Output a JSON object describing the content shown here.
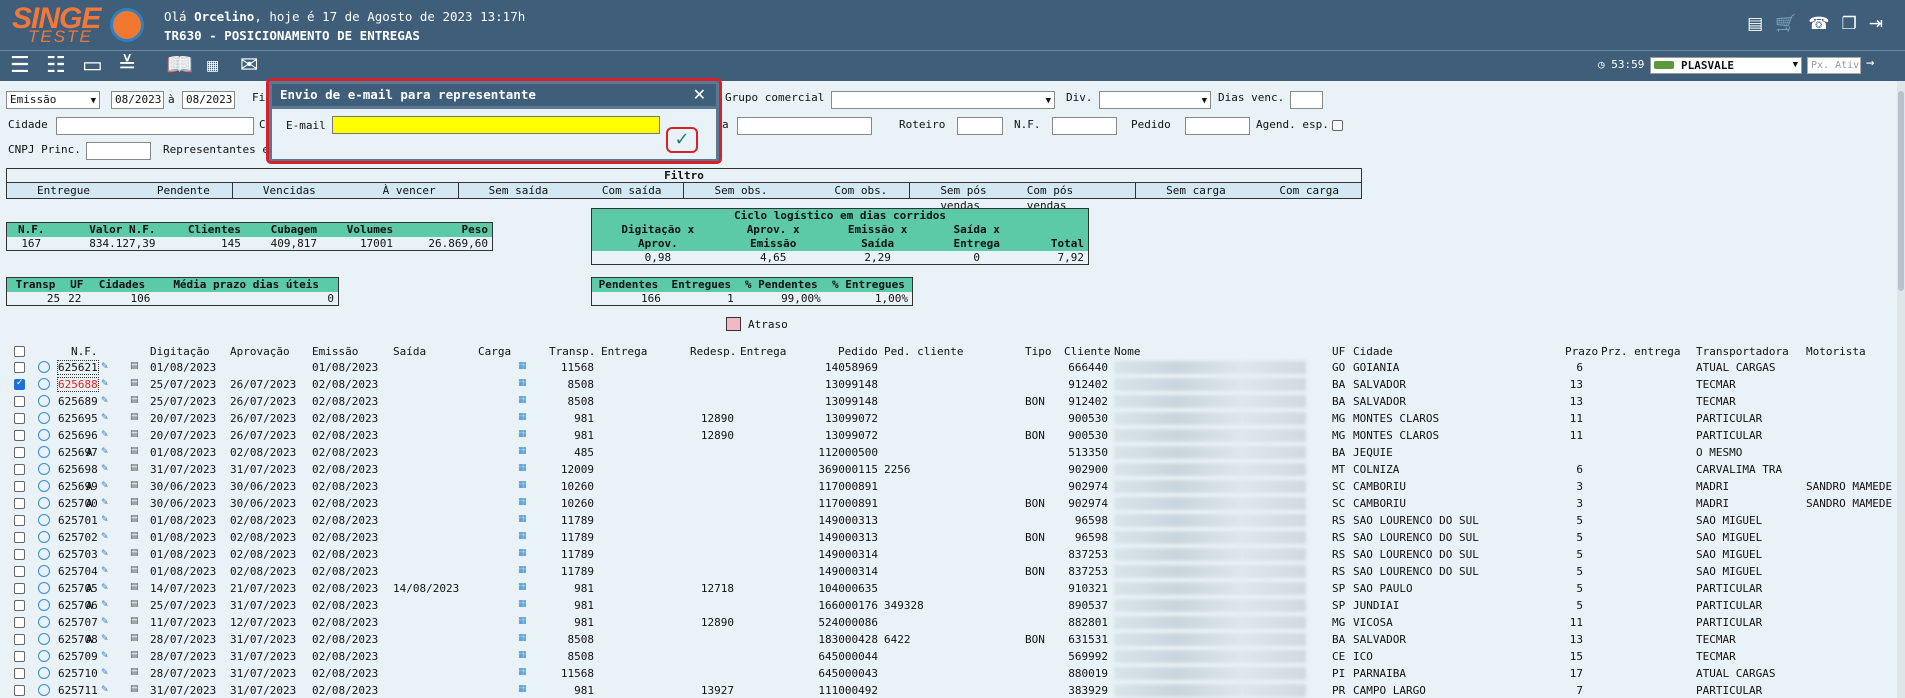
{
  "header": {
    "brand_top": "SINGE",
    "brand_bottom": "TESTE",
    "greeting_prefix": "Olá ",
    "user": "Orcelino",
    "greeting_suffix": ", hoje é 17 de Agosto de 2023 13:17h",
    "screen_title": "TR630 - POSICIONAMENTO DE ENTREGAS",
    "icons": [
      "document-icon",
      "cart-icon",
      "phone-icon",
      "copy-icon",
      "logout-icon"
    ]
  },
  "toolbar": {
    "time": "53:59",
    "company": "PLASVALE",
    "px_placeholder": "Px. Ativ",
    "icons": [
      "list-icon",
      "checklist-icon",
      "form-icon",
      "chevron-stack-icon",
      "book-icon",
      "csv-icon",
      "email-icon"
    ]
  },
  "filters": {
    "date_type": "Emissão",
    "date_from": "08/2023",
    "to_label": "à",
    "date_to": "08/2023",
    "fi_label": "Fi",
    "grupo_label": "Grupo comercial",
    "div_label": "Div.",
    "dias_label": "Dias venc.",
    "cidade_label": "Cidade",
    "c_label": "C",
    "a_label": "a",
    "roteiro_label": "Roteiro",
    "nf_label": "N.F.",
    "pedido_label": "Pedido",
    "agend_label": "Agend. esp.",
    "cnpj_label": "CNPJ Princ.",
    "repr_label": "Representantes e"
  },
  "filtro": {
    "title": "Filtro",
    "groups": [
      [
        "Entregue",
        "Pendente"
      ],
      [
        "Vencidas",
        "À vencer"
      ],
      [
        "Sem saída",
        "Com saída"
      ],
      [
        "Sem obs.",
        "Com obs."
      ],
      [
        "Sem pós vendas",
        "Com pós vendas"
      ],
      [
        "Sem carga",
        "Com carga"
      ]
    ]
  },
  "summary": {
    "headers": [
      "N.F.",
      "Valor N.F.",
      "Clientes",
      "Cubagem",
      "Volumes",
      "Peso"
    ],
    "values": [
      "167",
      "834.127,39",
      "145",
      "409,817",
      "17001",
      "26.869,60"
    ]
  },
  "transp": {
    "headers": [
      "Transp",
      "UF",
      "Cidades",
      "Média prazo dias úteis"
    ],
    "values": [
      "25",
      "22",
      "106",
      "0"
    ]
  },
  "ciclo": {
    "title": "Ciclo logístico em dias corridos",
    "h1": [
      "Digitação x",
      "Aprov. x",
      "Emissão x",
      "Saída x",
      ""
    ],
    "h2": [
      "Aprov.",
      "Emissão",
      "Saída",
      "Entrega",
      "Total"
    ],
    "values": [
      "0,98",
      "4,65",
      "2,29",
      "0",
      "7,92"
    ]
  },
  "pend": {
    "headers": [
      "Pendentes",
      "Entregues",
      "% Pendentes",
      "% Entregues"
    ],
    "values": [
      "166",
      "1",
      "99,00%",
      "1,00%"
    ]
  },
  "legend": {
    "atraso": "Atraso"
  },
  "modal": {
    "title": "Envio de e-mail para representante",
    "email_label": "E-mail",
    "email_value": ""
  },
  "grid": {
    "headers": [
      "N.F.",
      "Digitação",
      "Aprovação",
      "Emissão",
      "Saída",
      "Carga",
      "Transp.",
      "Entrega",
      "Redesp.",
      "Entrega",
      "Pedido",
      "Ped. cliente",
      "Tipo",
      "Cliente",
      "Nome",
      "UF",
      "Cidade",
      "Prazo",
      "Prz. entrega",
      "Transportadora",
      "Motorista"
    ],
    "rows": [
      {
        "nf": "625621",
        "a": "",
        "dig": "01/08/2023",
        "apr": "",
        "emi": "01/08/2023",
        "sai": "",
        "tr": "11568",
        "red": "",
        "ped": "14058969",
        "pc": "",
        "tipo": "",
        "cli": "666440",
        "uf": "GO",
        "cid": "GOIANIA",
        "prazo": "6",
        "transp": "ATUAL CARGAS",
        "mot": "",
        "checked": false,
        "red_text": false
      },
      {
        "nf": "625688",
        "a": "",
        "dig": "25/07/2023",
        "apr": "26/07/2023",
        "emi": "02/08/2023",
        "sai": "",
        "tr": "8508",
        "red": "",
        "ped": "13099148",
        "pc": "",
        "tipo": "",
        "cli": "912402",
        "uf": "BA",
        "cid": "SALVADOR",
        "prazo": "13",
        "transp": "TECMAR",
        "mot": "",
        "checked": true,
        "red_text": true
      },
      {
        "nf": "625689",
        "a": "",
        "dig": "25/07/2023",
        "apr": "26/07/2023",
        "emi": "02/08/2023",
        "sai": "",
        "tr": "8508",
        "red": "",
        "ped": "13099148",
        "pc": "",
        "tipo": "BON",
        "cli": "912402",
        "uf": "BA",
        "cid": "SALVADOR",
        "prazo": "13",
        "transp": "TECMAR",
        "mot": "",
        "checked": false,
        "red_text": false
      },
      {
        "nf": "625695",
        "a": "",
        "dig": "20/07/2023",
        "apr": "26/07/2023",
        "emi": "02/08/2023",
        "sai": "",
        "tr": "981",
        "red": "12890",
        "ped": "13099072",
        "pc": "",
        "tipo": "",
        "cli": "900530",
        "uf": "MG",
        "cid": "MONTES CLAROS",
        "prazo": "11",
        "transp": "PARTICULAR",
        "mot": "",
        "checked": false,
        "red_text": false
      },
      {
        "nf": "625696",
        "a": "",
        "dig": "20/07/2023",
        "apr": "26/07/2023",
        "emi": "02/08/2023",
        "sai": "",
        "tr": "981",
        "red": "12890",
        "ped": "13099072",
        "pc": "",
        "tipo": "BON",
        "cli": "900530",
        "uf": "MG",
        "cid": "MONTES CLAROS",
        "prazo": "11",
        "transp": "PARTICULAR",
        "mot": "",
        "checked": false,
        "red_text": false
      },
      {
        "nf": "625697",
        "a": "A",
        "dig": "01/08/2023",
        "apr": "02/08/2023",
        "emi": "02/08/2023",
        "sai": "",
        "tr": "485",
        "red": "",
        "ped": "112000500",
        "pc": "",
        "tipo": "",
        "cli": "513350",
        "uf": "BA",
        "cid": "JEQUIE",
        "prazo": "",
        "transp": "O MESMO",
        "mot": "",
        "checked": false,
        "red_text": false
      },
      {
        "nf": "625698",
        "a": "",
        "dig": "31/07/2023",
        "apr": "31/07/2023",
        "emi": "02/08/2023",
        "sai": "",
        "tr": "12009",
        "red": "",
        "ped": "369000115",
        "pc": "2256",
        "tipo": "",
        "cli": "902900",
        "uf": "MT",
        "cid": "COLNIZA",
        "prazo": "6",
        "transp": "CARVALIMA TRA",
        "mot": "",
        "checked": false,
        "red_text": false
      },
      {
        "nf": "625699",
        "a": "A",
        "dig": "30/06/2023",
        "apr": "30/06/2023",
        "emi": "02/08/2023",
        "sai": "",
        "tr": "10260",
        "red": "",
        "ped": "117000891",
        "pc": "",
        "tipo": "",
        "cli": "902974",
        "uf": "SC",
        "cid": "CAMBORIU",
        "prazo": "3",
        "transp": "MADRI",
        "mot": "SANDRO MAMEDE",
        "checked": false,
        "red_text": false
      },
      {
        "nf": "625700",
        "a": "A",
        "dig": "30/06/2023",
        "apr": "30/06/2023",
        "emi": "02/08/2023",
        "sai": "",
        "tr": "10260",
        "red": "",
        "ped": "117000891",
        "pc": "",
        "tipo": "BON",
        "cli": "902974",
        "uf": "SC",
        "cid": "CAMBORIU",
        "prazo": "3",
        "transp": "MADRI",
        "mot": "SANDRO MAMEDE",
        "checked": false,
        "red_text": false
      },
      {
        "nf": "625701",
        "a": "",
        "dig": "01/08/2023",
        "apr": "02/08/2023",
        "emi": "02/08/2023",
        "sai": "",
        "tr": "11789",
        "red": "",
        "ped": "149000313",
        "pc": "",
        "tipo": "",
        "cli": "96598",
        "uf": "RS",
        "cid": "SAO LOURENCO DO SUL",
        "prazo": "5",
        "transp": "SAO MIGUEL",
        "mot": "",
        "checked": false,
        "red_text": false
      },
      {
        "nf": "625702",
        "a": "",
        "dig": "01/08/2023",
        "apr": "02/08/2023",
        "emi": "02/08/2023",
        "sai": "",
        "tr": "11789",
        "red": "",
        "ped": "149000313",
        "pc": "",
        "tipo": "BON",
        "cli": "96598",
        "uf": "RS",
        "cid": "SAO LOURENCO DO SUL",
        "prazo": "5",
        "transp": "SAO MIGUEL",
        "mot": "",
        "checked": false,
        "red_text": false
      },
      {
        "nf": "625703",
        "a": "",
        "dig": "01/08/2023",
        "apr": "02/08/2023",
        "emi": "02/08/2023",
        "sai": "",
        "tr": "11789",
        "red": "",
        "ped": "149000314",
        "pc": "",
        "tipo": "",
        "cli": "837253",
        "uf": "RS",
        "cid": "SAO LOURENCO DO SUL",
        "prazo": "5",
        "transp": "SAO MIGUEL",
        "mot": "",
        "checked": false,
        "red_text": false
      },
      {
        "nf": "625704",
        "a": "",
        "dig": "01/08/2023",
        "apr": "02/08/2023",
        "emi": "02/08/2023",
        "sai": "",
        "tr": "11789",
        "red": "",
        "ped": "149000314",
        "pc": "",
        "tipo": "BON",
        "cli": "837253",
        "uf": "RS",
        "cid": "SAO LOURENCO DO SUL",
        "prazo": "5",
        "transp": "SAO MIGUEL",
        "mot": "",
        "checked": false,
        "red_text": false
      },
      {
        "nf": "625705",
        "a": "A",
        "dig": "14/07/2023",
        "apr": "21/07/2023",
        "emi": "02/08/2023",
        "sai": "14/08/2023",
        "tr": "981",
        "red": "12718",
        "ped": "104000635",
        "pc": "",
        "tipo": "",
        "cli": "910321",
        "uf": "SP",
        "cid": "SAO PAULO",
        "prazo": "5",
        "transp": "PARTICULAR",
        "mot": "",
        "checked": false,
        "red_text": false
      },
      {
        "nf": "625706",
        "a": "A",
        "dig": "25/07/2023",
        "apr": "31/07/2023",
        "emi": "02/08/2023",
        "sai": "",
        "tr": "981",
        "red": "",
        "ped": "166000176",
        "pc": "349328",
        "tipo": "",
        "cli": "890537",
        "uf": "SP",
        "cid": "JUNDIAI",
        "prazo": "5",
        "transp": "PARTICULAR",
        "mot": "",
        "checked": false,
        "red_text": false
      },
      {
        "nf": "625707",
        "a": "",
        "dig": "11/07/2023",
        "apr": "12/07/2023",
        "emi": "02/08/2023",
        "sai": "",
        "tr": "981",
        "red": "12890",
        "ped": "524000086",
        "pc": "",
        "tipo": "",
        "cli": "882801",
        "uf": "MG",
        "cid": "VICOSA",
        "prazo": "11",
        "transp": "PARTICULAR",
        "mot": "",
        "checked": false,
        "red_text": false
      },
      {
        "nf": "625708",
        "a": "A",
        "dig": "28/07/2023",
        "apr": "31/07/2023",
        "emi": "02/08/2023",
        "sai": "",
        "tr": "8508",
        "red": "",
        "ped": "183000428",
        "pc": "6422",
        "tipo": "BON",
        "cli": "631531",
        "uf": "BA",
        "cid": "SALVADOR",
        "prazo": "13",
        "transp": "TECMAR",
        "mot": "",
        "checked": false,
        "red_text": false
      },
      {
        "nf": "625709",
        "a": "",
        "dig": "28/07/2023",
        "apr": "31/07/2023",
        "emi": "02/08/2023",
        "sai": "",
        "tr": "8508",
        "red": "",
        "ped": "645000044",
        "pc": "",
        "tipo": "",
        "cli": "569992",
        "uf": "CE",
        "cid": "ICO",
        "prazo": "15",
        "transp": "TECMAR",
        "mot": "",
        "checked": false,
        "red_text": false
      },
      {
        "nf": "625710",
        "a": "",
        "dig": "28/07/2023",
        "apr": "31/07/2023",
        "emi": "02/08/2023",
        "sai": "",
        "tr": "11568",
        "red": "",
        "ped": "645000043",
        "pc": "",
        "tipo": "",
        "cli": "880019",
        "uf": "PI",
        "cid": "PARNAIBA",
        "prazo": "17",
        "transp": "ATUAL CARGAS",
        "mot": "",
        "checked": false,
        "red_text": false
      },
      {
        "nf": "625711",
        "a": "",
        "dig": "31/07/2023",
        "apr": "31/07/2023",
        "emi": "02/08/2023",
        "sai": "",
        "tr": "981",
        "red": "13927",
        "ped": "111000492",
        "pc": "",
        "tipo": "",
        "cli": "383929",
        "uf": "PR",
        "cid": "CAMPO LARGO",
        "prazo": "7",
        "transp": "PARTICULAR",
        "mot": "",
        "checked": false,
        "red_text": false
      }
    ]
  }
}
